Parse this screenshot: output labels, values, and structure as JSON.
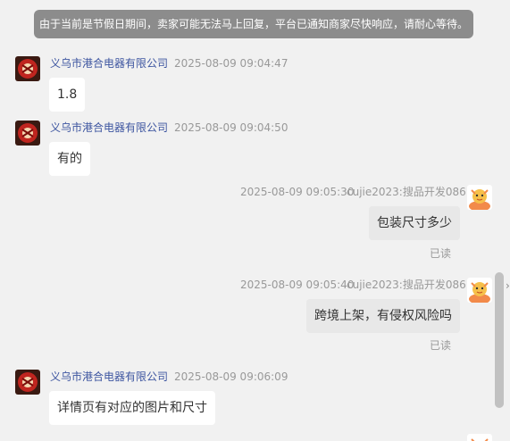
{
  "notice": "由于当前是节假日期间，卖家可能无法马上回复，平台已通知商家尽快响应，请耐心等待。",
  "messages": [
    {
      "side": "left",
      "shop": "义乌市港合电器有限公司",
      "time": "2025-08-09 09:04:47",
      "text": "1.8"
    },
    {
      "side": "left",
      "shop": "义乌市港合电器有限公司",
      "time": "2025-08-09 09:04:50",
      "text": "有的"
    },
    {
      "side": "right",
      "time": "2025-08-09 09:05:30",
      "sender": "cujie2023:搜品开发086",
      "text": "包装尺寸多少",
      "status": "已读"
    },
    {
      "side": "right",
      "time": "2025-08-09 09:05:40",
      "sender": "cujie2023:搜品开发086",
      "text": "跨境上架，有侵权风险吗",
      "status": "已读"
    },
    {
      "side": "left",
      "shop": "义乌市港合电器有限公司",
      "time": "2025-08-09 09:06:09",
      "text": "详情页有对应的图片和尺寸"
    }
  ],
  "icons": {
    "shop_avatar": "shop-logo-avatar",
    "user_avatar": "cartoon-user-avatar",
    "scroll_arrow": "chevron-right-icon"
  },
  "colors": {
    "shop_name": "#3d55a0",
    "notice_bg": "#8c8c8c",
    "right_bubble": "#e8e8e8"
  }
}
